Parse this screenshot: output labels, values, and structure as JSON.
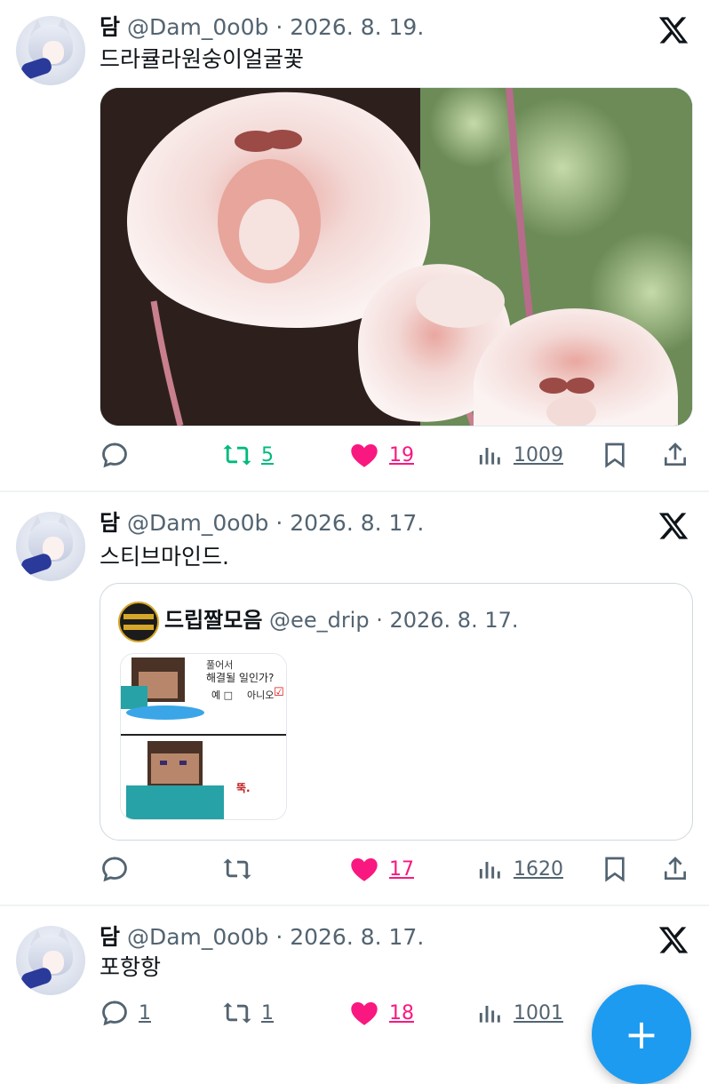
{
  "colors": {
    "accent": "#1d9bf0",
    "like": "#f91880",
    "retweet_active": "#00ba7c",
    "muted": "#536471"
  },
  "tweets": [
    {
      "name": "담",
      "meta": "@Dam_0o0b · 2026. 8. 19.",
      "text": "드라큘라원숭이얼굴꽃",
      "reply_count": "",
      "retweet_count": "5",
      "like_count": "19",
      "view_count": "1009"
    },
    {
      "name": "담",
      "meta": "@Dam_0o0b · 2026. 8. 17.",
      "text": "스티브마인드.",
      "reply_count": "",
      "retweet_count": "",
      "like_count": "17",
      "view_count": "1620",
      "quote": {
        "name": "드립짤모음",
        "meta": "@ee_drip · 2026. 8. 17.",
        "image_text_top": "풀어서",
        "image_text_question": "해결될 일인가?",
        "image_text_yes": "예 □",
        "image_text_no": "아니오",
        "image_text_bottom": "뚝."
      }
    },
    {
      "name": "담",
      "meta": "@Dam_0o0b · 2026. 8. 17.",
      "text": "포항항",
      "reply_count": "1",
      "retweet_count": "1",
      "like_count": "18",
      "view_count": "1001"
    }
  ],
  "fab_label": "+"
}
